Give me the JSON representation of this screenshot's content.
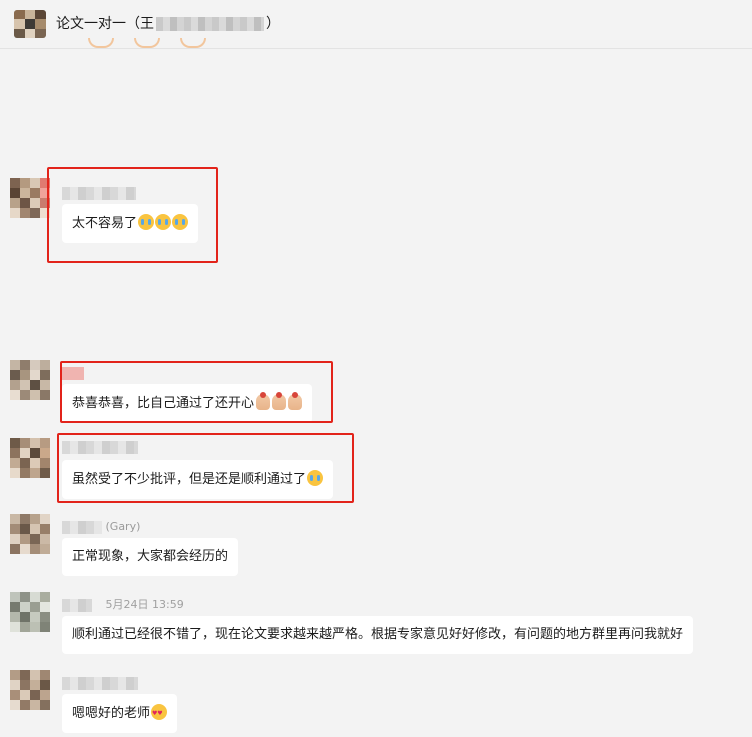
{
  "header": {
    "title_prefix": "论文一对一（王",
    "title_suffix": "）"
  },
  "messages": [
    {
      "text": "太不容易了",
      "emojis": [
        "crying-face",
        "crying-face",
        "crying-face"
      ]
    },
    {
      "text": "恭喜恭喜，比自己通过了还开心",
      "emojis": [
        "clap-hand",
        "clap-hand",
        "clap-hand"
      ]
    },
    {
      "text": "虽然受了不少批评，但是还是顺利通过了",
      "emojis": [
        "crying-face"
      ]
    },
    {
      "sender_suffix": "(Gary)",
      "text": "正常现象，大家都会经历的"
    },
    {
      "time": "5月24日 13:59",
      "text": "顺利通过已经很不错了，现在论文要求越来越严格。根据专家意见好好修改，有问题的地方群里再问我就好"
    },
    {
      "text": "嗯嗯好的老师",
      "emojis": [
        "heart-eyes-face"
      ]
    }
  ]
}
